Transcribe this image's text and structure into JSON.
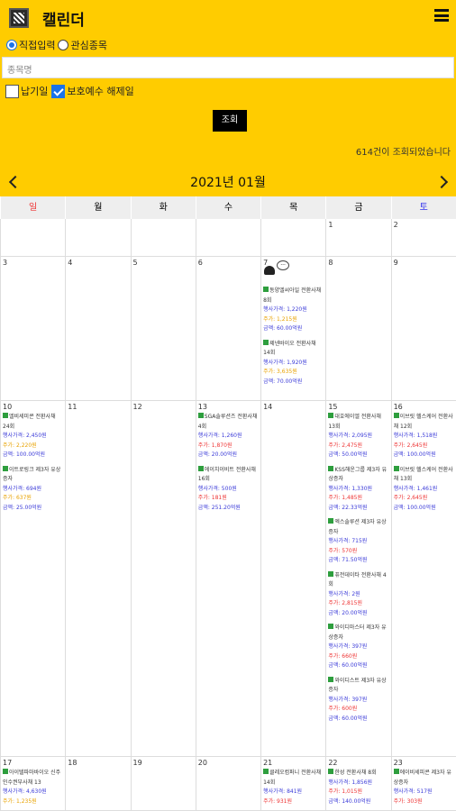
{
  "app": {
    "title": "캘린더"
  },
  "filters": {
    "radio1": "직접입력",
    "radio2": "관심종목",
    "search_placeholder": "종목명",
    "check1": "납기일",
    "check2": "보호예수 해제일",
    "submit": "조회",
    "count_text": "614건이 조회되었습니다"
  },
  "calendar": {
    "month": "2021년 01월",
    "days": [
      "일",
      "월",
      "화",
      "수",
      "목",
      "금",
      "토"
    ],
    "colors": {
      "sun": "#ee3333",
      "sat": "#3333ee"
    },
    "weeks": [
      [
        {
          "d": ""
        },
        {
          "d": ""
        },
        {
          "d": ""
        },
        {
          "d": ""
        },
        {
          "d": ""
        },
        {
          "d": "1"
        },
        {
          "d": "2"
        }
      ],
      [
        {
          "d": "3"
        },
        {
          "d": "4"
        },
        {
          "d": "5"
        },
        {
          "d": "6"
        },
        {
          "d": "7",
          "ev": [
            {
              "n": "동양엘씨아일 전환사채 8회",
              "a": "행사가격: 1,220원",
              "b": "주가: 1,215원",
              "c": "금액: 60.00억원"
            },
            {
              "n": "제넨바이오 전환사채 14회",
              "a": "행사가격: 1,920원",
              "b": "주가: 3,635원",
              "c": "금액: 70.00억원"
            }
          ]
        },
        {
          "d": "8"
        },
        {
          "d": "9"
        }
      ],
      [
        {
          "d": "10",
          "ev": [
            {
              "n": "엘비세미콘 전환사채 24회",
              "a": "행사가격: 2,450원",
              "b": "주가: 2,220원",
              "c": "금액: 100.00억원"
            },
            {
              "n": "이트로링크 제3자 유상증자",
              "a": "행사가격: 694원",
              "b": "주가: 637원",
              "c": "금액: 25.00억원"
            }
          ]
        },
        {
          "d": "11"
        },
        {
          "d": "12"
        },
        {
          "d": "13",
          "ev": [
            {
              "n": "SGA솔루션즈 전환사채 4회",
              "a": "행사가격: 1,260원",
              "b": "주가: 1,870원",
              "c": "금액: 20.00억원"
            },
            {
              "n": "에이치이비트 전환사채 16회",
              "a": "행사가격: 500원",
              "b": "주가: 181원",
              "c": "금액: 251.20억원"
            }
          ]
        },
        {
          "d": "14"
        },
        {
          "d": "15",
          "ev": [
            {
              "n": "대호에이엘 전환사채 13회",
              "a": "행사가격: 2,095원",
              "b": "주가: 2,475원",
              "c": "금액: 50.00억원"
            },
            {
              "n": "KSS해운그룹 제3자 유상증자",
              "a": "행사가격: 1,330원",
              "b": "주가: 1,485원",
              "c": "금액: 22.33억원"
            },
            {
              "n": "엑스솔루션 제3자 유상증자",
              "a": "행사가격: 715원",
              "b": "주가: 570원",
              "c": "금액: 71.50억원"
            },
            {
              "n": "퓨전데이타 전환사채 4회",
              "a": "행사가격: 2원",
              "b": "주가: 2,815원",
              "c": "금액: 20.00억원"
            },
            {
              "n": "와이디마스터 제3자 유상증자",
              "a": "행사가격: 397원",
              "b": "주가: 660원",
              "c": "금액: 60.00억원"
            },
            {
              "n": "와이디스트 제3자 유상증자",
              "a": "행사가격: 397원",
              "b": "주가: 600원",
              "c": "금액: 60.00억원"
            }
          ]
        },
        {
          "d": "16",
          "ev": [
            {
              "n": "이브릿 헬스케어 전환사채 12회",
              "a": "행사가격: 1,518원",
              "b": "주가: 2,645원",
              "c": "금액: 100.00억원"
            },
            {
              "n": "이브릿 헬스케어 전환사채 13회",
              "a": "행사가격: 1,461원",
              "b": "주가: 2,645원",
              "c": "금액: 100.00억원"
            }
          ]
        }
      ],
      [
        {
          "d": "17",
          "ev": [
            {
              "n": "아이텔파마바이오 신주인수권부사채 13",
              "a": "행사가격: 4,630원",
              "b": "주가: 1,235원",
              "c": ""
            }
          ]
        },
        {
          "d": "18"
        },
        {
          "d": "19"
        },
        {
          "d": "20"
        },
        {
          "d": "21",
          "ev": [
            {
              "n": "클레오컴퍼니 전환사채 14회",
              "a": "행사가격: 841원",
              "b": "주가: 931원",
              "c": ""
            }
          ]
        },
        {
          "d": "22",
          "ev": [
            {
              "n": "한성 전환사채 8회",
              "a": "행사가격: 1,856원",
              "b": "주가: 1,015원",
              "c": "금액: 140.00억원"
            }
          ]
        },
        {
          "d": "23",
          "ev": [
            {
              "n": "에이비세피콘 제3자 유상증자",
              "a": "행사가격: 517원",
              "b": "주가: 303원",
              "c": ""
            }
          ]
        }
      ]
    ]
  }
}
